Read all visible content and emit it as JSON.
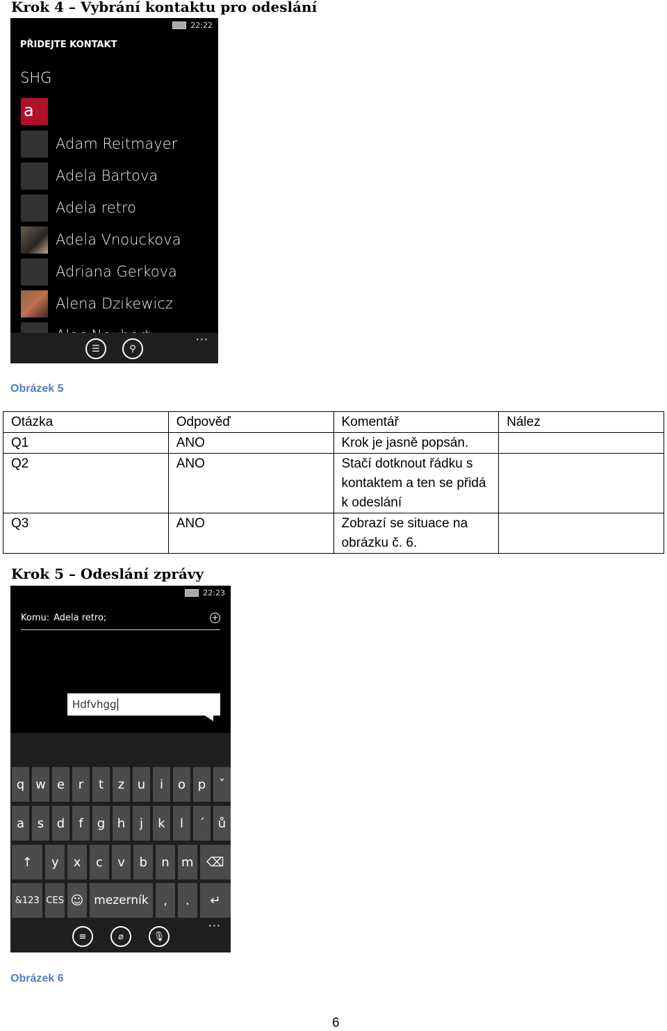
{
  "step4": {
    "heading": "Krok 4 – Vybrání kontaktu pro odeslání",
    "phone": {
      "time": "22:22",
      "title": "PŘIDEJTE KONTAKT",
      "group": "SHG",
      "letter": "a",
      "contacts": [
        "Adam Reitmayer",
        "Adela Bartova",
        "Adela retro",
        "Adela Vnouckova",
        "Adriana Gerkova",
        "Alena Dzikewicz",
        "Alec Neubert"
      ],
      "more": "···",
      "accent": "#b0102a"
    },
    "caption": "Obrázek 5"
  },
  "table": {
    "headers": [
      "Otázka",
      "Odpověď",
      "Komentář",
      "Nález"
    ],
    "rows": [
      [
        "Q1",
        "ANO",
        "Krok je jasně popsán.",
        ""
      ],
      [
        "Q2",
        "ANO",
        "Stačí dotknout řádku s kontaktem a ten se přidá k odeslání",
        ""
      ],
      [
        "Q3",
        "ANO",
        "Zobrazí se situace na obrázku č. 6.",
        ""
      ]
    ]
  },
  "step5": {
    "heading": "Krok 5 – Odeslání zprávy",
    "phone": {
      "time": "22:23",
      "to_label": "Komu:",
      "to_value": "Adela retro;",
      "message": "Hdfvhgg",
      "keyboard": {
        "row1": [
          "q",
          "w",
          "e",
          "r",
          "t",
          "z",
          "u",
          "i",
          "o",
          "p",
          "ˇ"
        ],
        "row2": [
          "a",
          "s",
          "d",
          "f",
          "g",
          "h",
          "j",
          "k",
          "l",
          "´",
          "ů"
        ],
        "row3": [
          "↑",
          "y",
          "x",
          "c",
          "v",
          "b",
          "n",
          "m",
          "⌫"
        ],
        "row4": [
          "&123",
          "CES",
          "☺",
          "mezerník",
          ",",
          ".",
          "↵"
        ]
      },
      "more": "···"
    },
    "caption": "Obrázek 6"
  },
  "page_number": "6"
}
